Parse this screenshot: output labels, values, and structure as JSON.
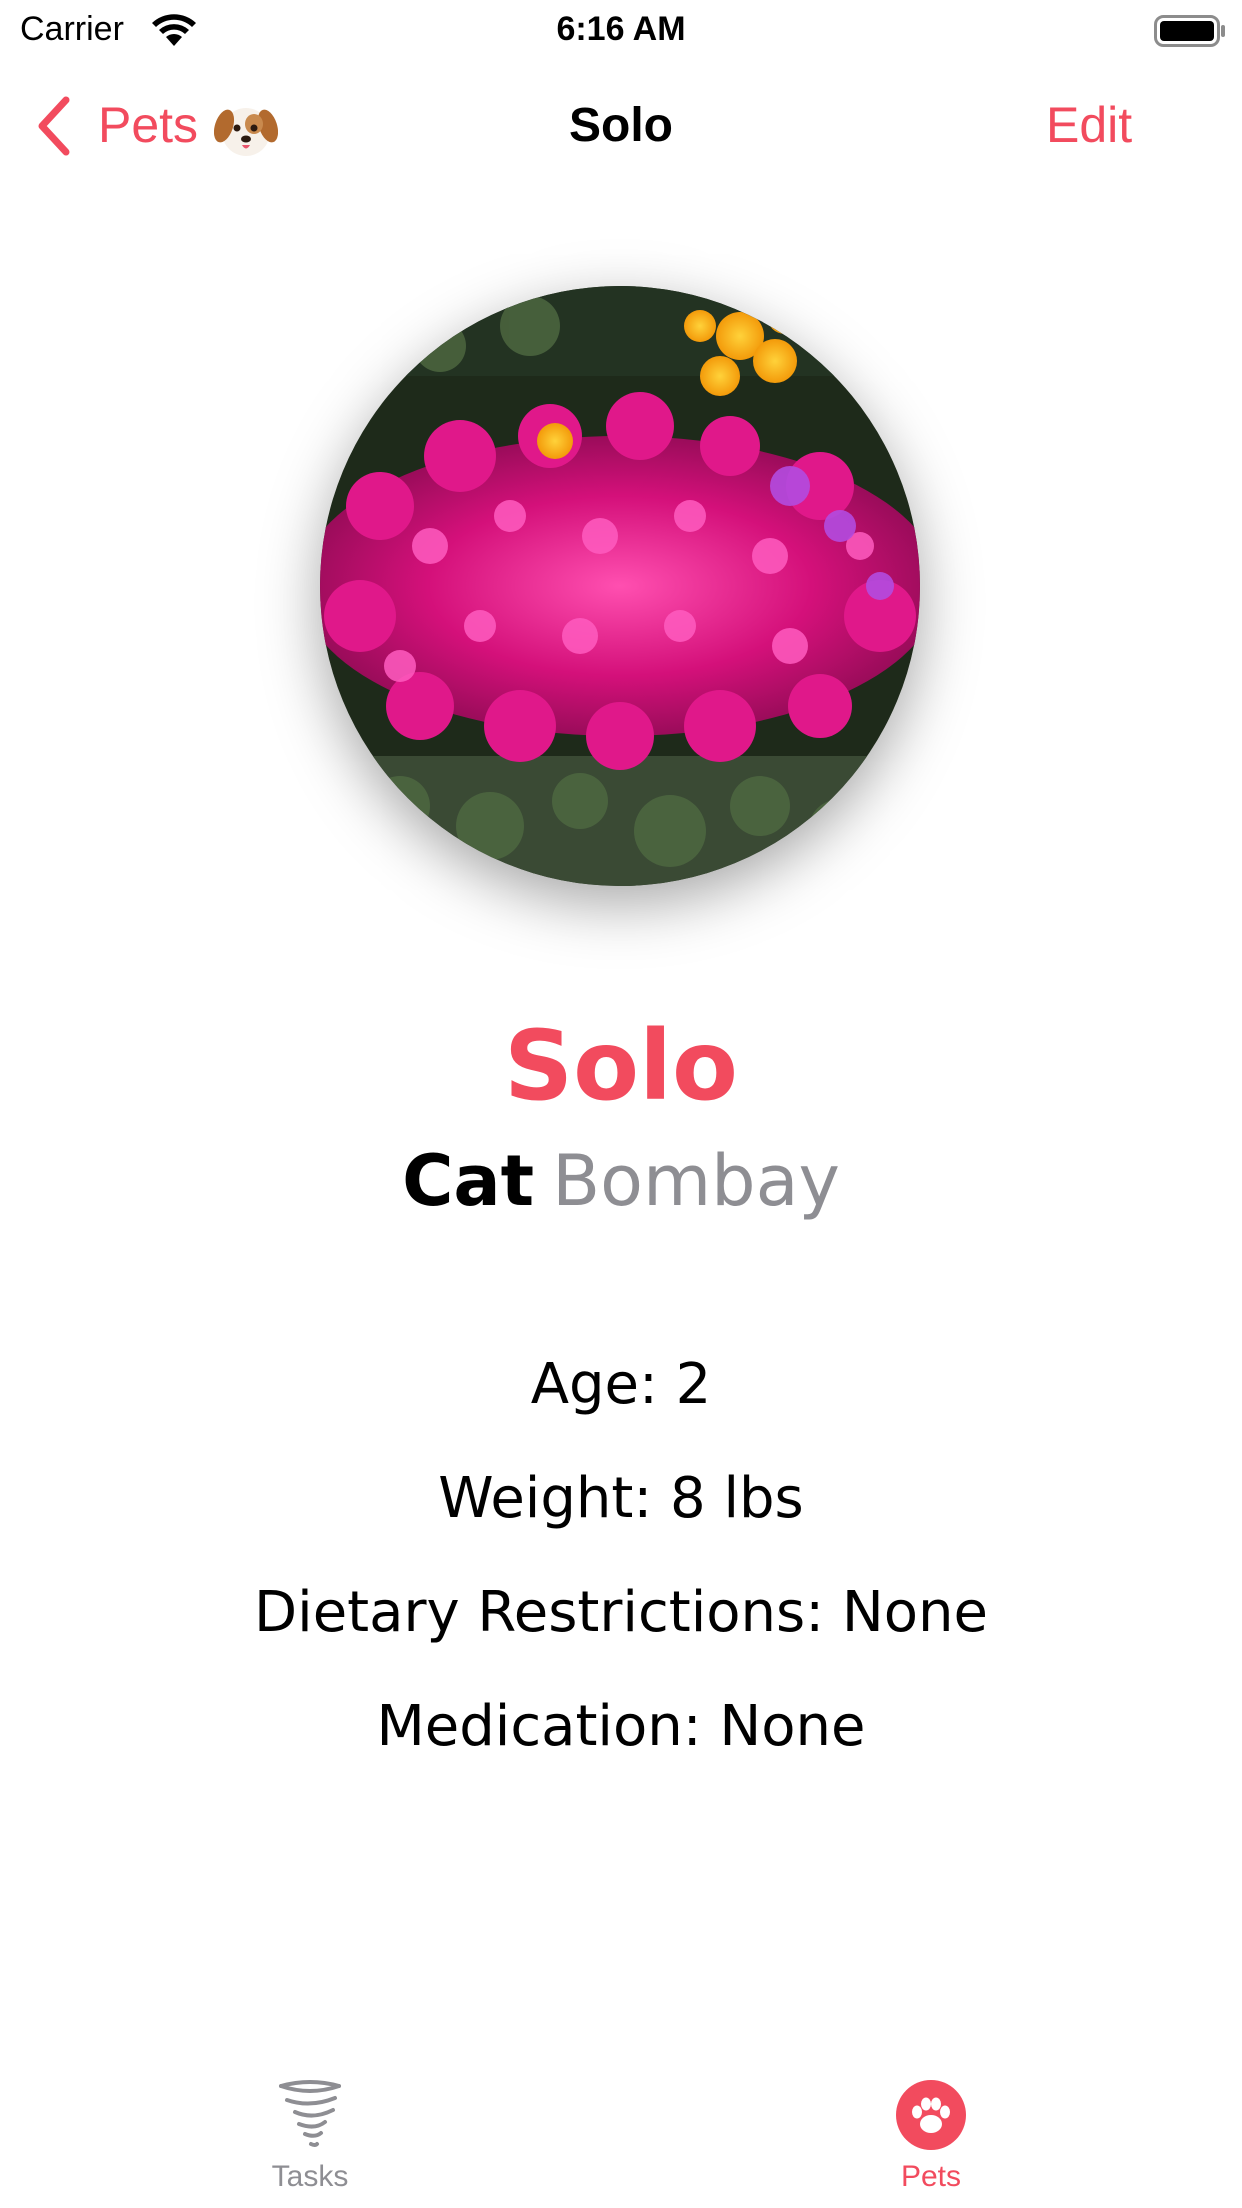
{
  "status_bar": {
    "carrier": "Carrier",
    "time": "6:16 AM"
  },
  "nav": {
    "back_label": "Pets",
    "back_icon": "chevron-left-icon",
    "emoji_icon": "dog-face-icon",
    "title": "Solo",
    "edit_label": "Edit"
  },
  "pet": {
    "name": "Solo",
    "species": "Cat",
    "breed": "Bombay",
    "photo_icon": "pet-photo-flowers"
  },
  "details": {
    "age": "Age: 2",
    "weight": "Weight: 8 lbs",
    "dietary": "Dietary Restrictions: None",
    "medication": "Medication: None"
  },
  "tab_bar": {
    "tabs": [
      {
        "label": "Tasks",
        "icon": "tornado-icon",
        "selected": false
      },
      {
        "label": "Pets",
        "icon": "paw-icon",
        "selected": true
      }
    ]
  },
  "colors": {
    "accent": "#f24b5e",
    "secondary_text": "#8e8e93",
    "text": "#000000",
    "background": "#ffffff"
  }
}
